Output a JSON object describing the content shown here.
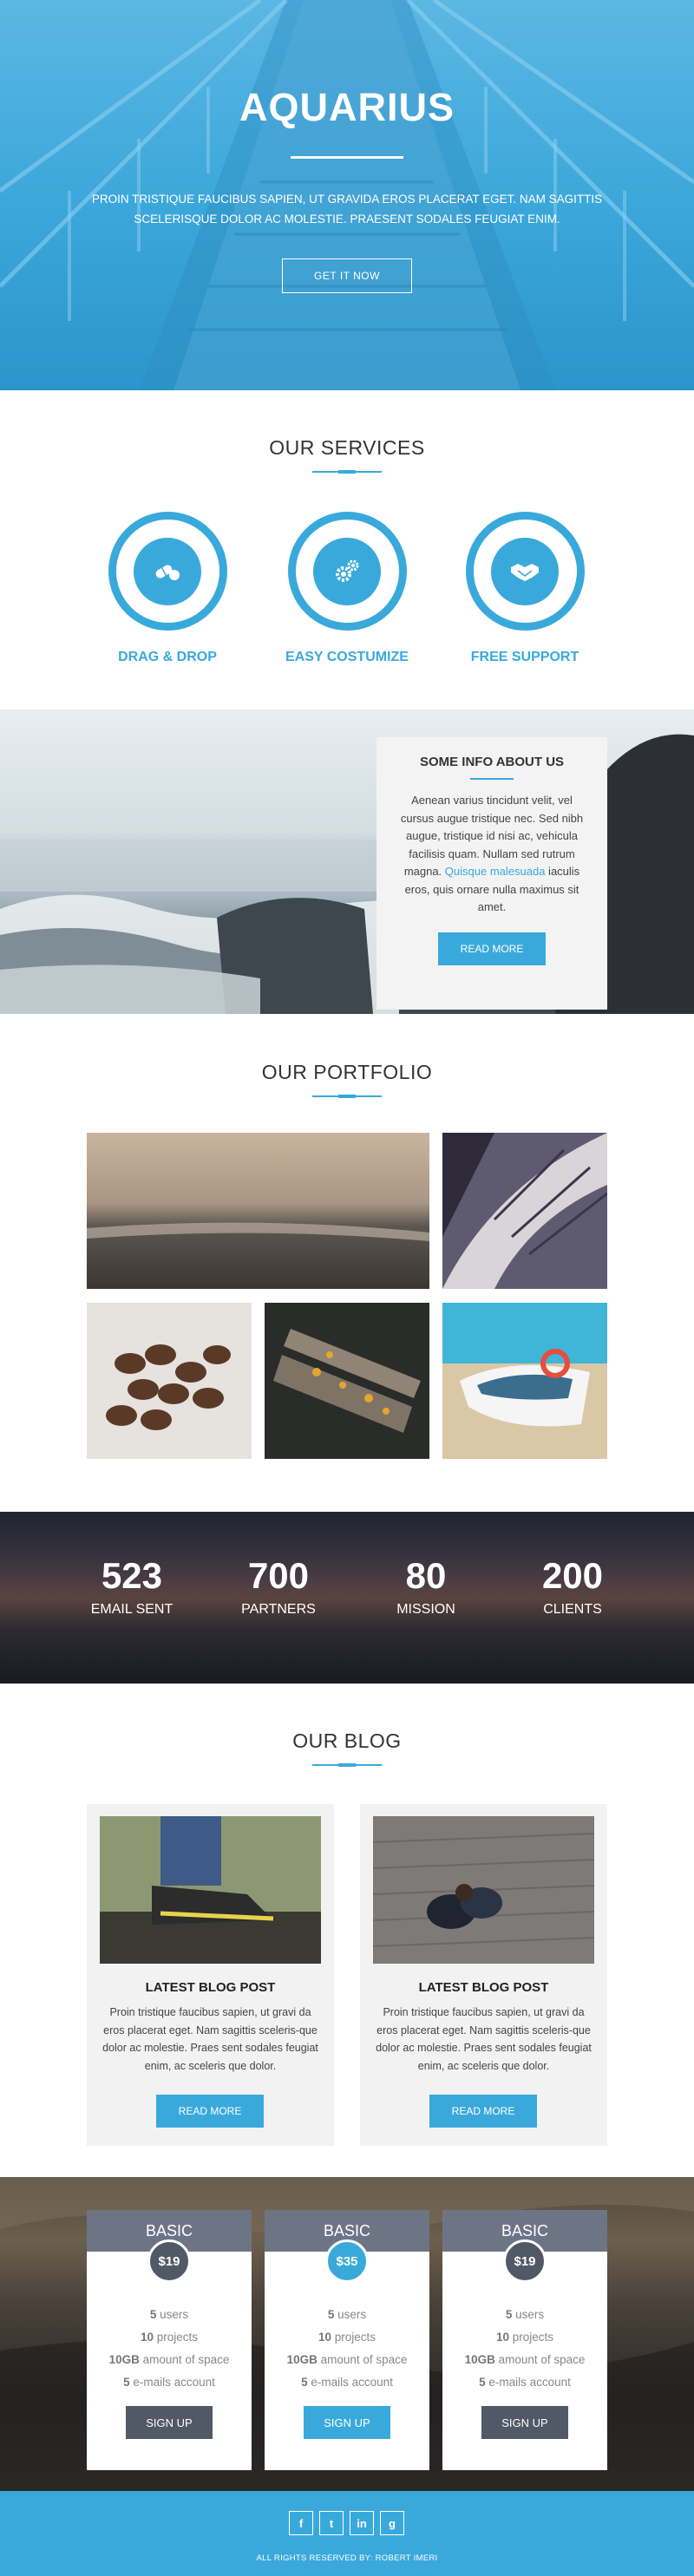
{
  "hero": {
    "title": "AQUARIUS",
    "text": "PROIN TRISTIQUE FAUCIBUS SAPIEN, UT GRAVIDA EROS PLACERAT EGET. NAM SAGITTIS SCELERISQUE DOLOR AC MOLESTIE. PRAESENT SODALES FEUGIAT ENIM.",
    "button": "GET IT NOW"
  },
  "services": {
    "title": "OUR SERVICES",
    "items": [
      {
        "label": "DRAG & DROP",
        "icon": "pills-icon"
      },
      {
        "label": "EASY COSTUMIZE",
        "icon": "gears-icon"
      },
      {
        "label": "FREE SUPPORT",
        "icon": "handshake-icon"
      }
    ]
  },
  "info": {
    "title": "SOME INFO ABOUT US",
    "text_before": "Aenean varius tincidunt velit, vel cursus augue tristique nec. Sed nibh augue, tristique id nisi ac, vehicula facilisis quam. Nullam sed rutrum magna. ",
    "link": "Quisque malesuada",
    "text_after": " iaculis eros, quis ornare nulla maximus sit amet.",
    "button": "READ MORE"
  },
  "portfolio": {
    "title": "OUR PORTFOLIO"
  },
  "counters": [
    {
      "value": "523",
      "label": "EMAIL SENT"
    },
    {
      "value": "700",
      "label": "PARTNERS"
    },
    {
      "value": "80",
      "label": "MISSION"
    },
    {
      "value": "200",
      "label": "CLIENTS"
    }
  ],
  "blog": {
    "title": "OUR BLOG",
    "posts": [
      {
        "title": "LATEST BLOG POST",
        "text": "Proin tristique faucibus sapien, ut gravi da eros placerat eget. Nam sagittis sceleris-que dolor ac molestie. Praes sent sodales feugiat enim, ac sceleris que dolor.",
        "button": "READ MORE"
      },
      {
        "title": "LATEST BLOG POST",
        "text": "Proin tristique faucibus sapien, ut gravi da eros placerat eget. Nam sagittis sceleris-que dolor ac molestie. Praes sent sodales feugiat enim, ac sceleris que dolor.",
        "button": "READ MORE"
      }
    ]
  },
  "pricing": [
    {
      "name": "BASIC",
      "price": "$19",
      "users": "5",
      "users_label": " users",
      "projects": "10",
      "projects_label": " projects",
      "space": "10GB",
      "space_label": " amount of space",
      "email": "5",
      "email_label": " e-mails account",
      "button": "SIGN UP"
    },
    {
      "name": "BASIC",
      "price": "$35",
      "users": "5",
      "users_label": " users",
      "projects": "10",
      "projects_label": " projects",
      "space": "10GB",
      "space_label": " amount of space",
      "email": "5",
      "email_label": " e-mails account",
      "button": "SIGN UP"
    },
    {
      "name": "BASIC",
      "price": "$19",
      "users": "5",
      "users_label": " users",
      "projects": "10",
      "projects_label": " projects",
      "space": "10GB",
      "space_label": " amount of space",
      "email": "5",
      "email_label": " e-mails account",
      "button": "SIGN UP"
    }
  ],
  "footer": {
    "social": [
      {
        "icon": "facebook-icon",
        "glyph": "f"
      },
      {
        "icon": "twitter-icon",
        "glyph": "t"
      },
      {
        "icon": "linkedin-icon",
        "glyph": "in"
      },
      {
        "icon": "googleplus-icon",
        "glyph": "g"
      }
    ],
    "text": "ALL RIGHTS RESERVED BY: ROBERT IMERI"
  },
  "colors": {
    "accent": "#39a9dc",
    "slate": "#6d7585",
    "dark_button": "#515866"
  }
}
